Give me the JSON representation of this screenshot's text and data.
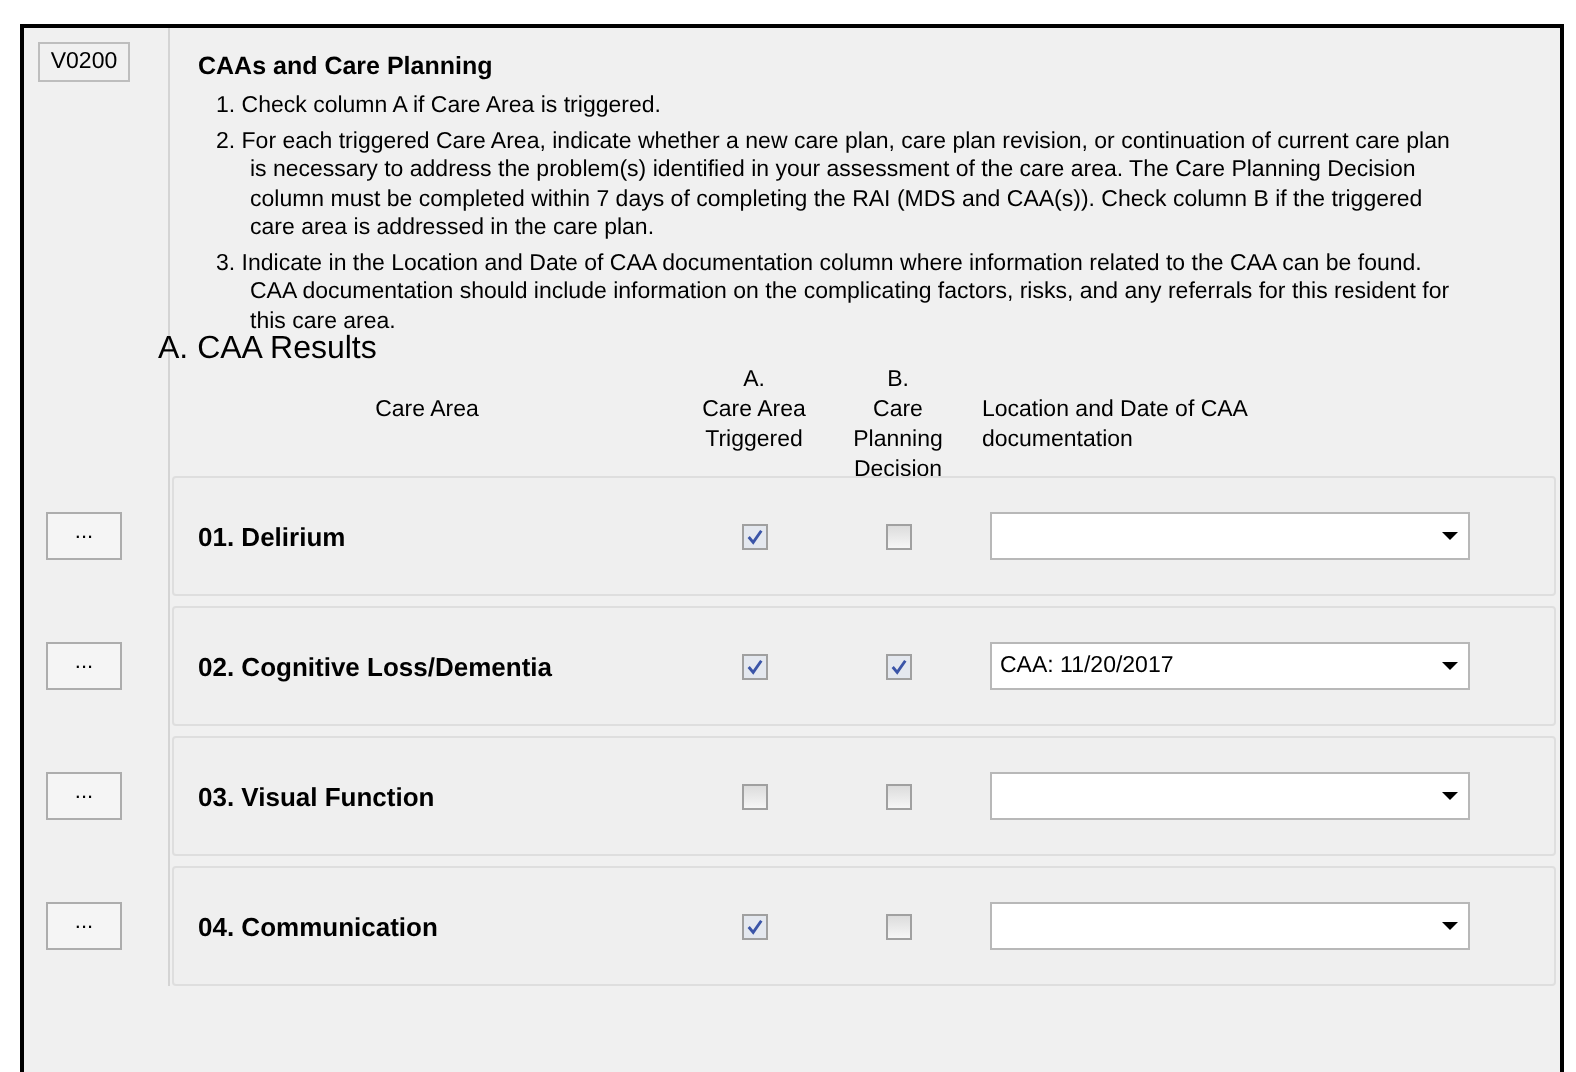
{
  "item_code": "V0200",
  "title": "CAAs and Care Planning",
  "instructions": [
    "1. Check column A if Care Area is triggered.",
    "2. For each triggered Care Area, indicate whether a new care plan, care plan revision, or continuation of current care plan is necessary to address the problem(s) identified in your assessment of the care area. The Care Planning Decision column must be completed within 7 days of completing the RAI (MDS and CAA(s)).  Check column B if the triggered care area is addressed in the care plan.",
    "3. Indicate in the Location and Date of CAA documentation column where information related to the CAA can be found.  CAA documentation should include information on the complicating factors, risks, and any referrals for this resident for this care area."
  ],
  "section_title": "A.  CAA Results",
  "columns": {
    "care_area": "Care Area",
    "a_letter": "A.",
    "a_label": "Care Area Triggered",
    "b_letter": "B.",
    "b_label": "Care Planning Decision",
    "location": "Location and Date of CAA documentation"
  },
  "rows": [
    {
      "button": "...",
      "label": "01. Delirium",
      "triggered": true,
      "decision": false,
      "location": ""
    },
    {
      "button": "...",
      "label": "02. Cognitive Loss/Dementia",
      "triggered": true,
      "decision": true,
      "location": "CAA: 11/20/2017"
    },
    {
      "button": "...",
      "label": "03.  Visual Function",
      "triggered": false,
      "decision": false,
      "location": ""
    },
    {
      "button": "...",
      "label": "04.  Communication",
      "triggered": true,
      "decision": false,
      "location": ""
    }
  ]
}
